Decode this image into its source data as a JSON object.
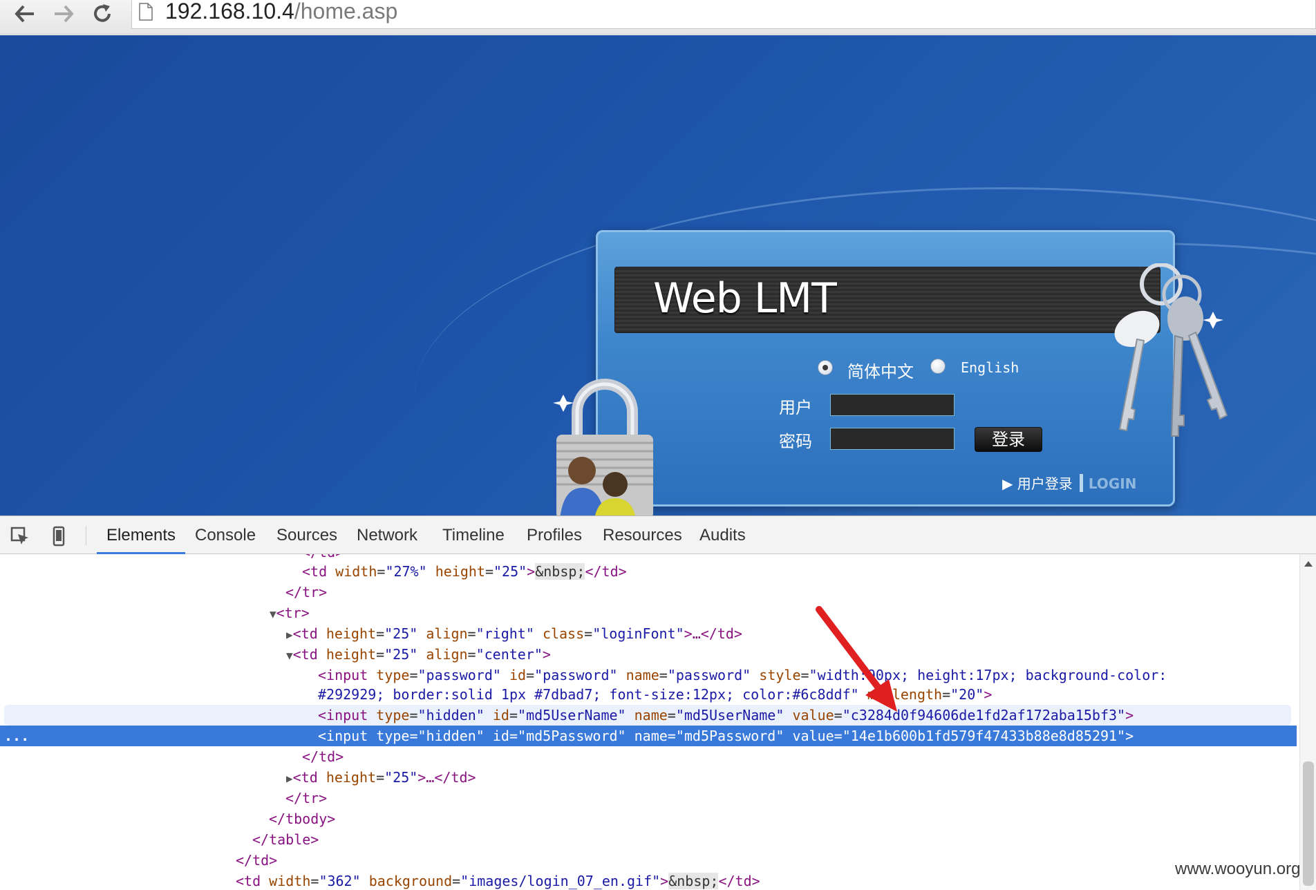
{
  "browser": {
    "url_host": "192.168.10.4",
    "url_path": "/home.asp"
  },
  "login_page": {
    "title": "Web LMT",
    "language_options": [
      {
        "label": "简体中文",
        "selected": true
      },
      {
        "label": "English",
        "selected": false
      }
    ],
    "username_label": "用户",
    "password_label": "密码",
    "login_button": "登录",
    "footer_login_cn": "▶ 用户登录",
    "footer_login_en": "LOGIN"
  },
  "devtools": {
    "tabs": [
      "Elements",
      "Console",
      "Sources",
      "Network",
      "Timeline",
      "Profiles",
      "Resources",
      "Audits"
    ],
    "active_tab": "Elements",
    "selection_ellipsis": "..."
  },
  "code": {
    "l1": {
      "tag1": "<td",
      "a1": "width",
      "v1": "\"27%\"",
      "a2": "height",
      "v2": "\"25\"",
      "t1": ">",
      "ent": "&nbsp;",
      "t2": "</td>"
    },
    "l2": {
      "tag": "</tr>"
    },
    "l3": {
      "tag": "<tr>"
    },
    "l4": {
      "tag1": "<td",
      "a1": "height",
      "v1": "\"25\"",
      "a2": "align",
      "v2": "\"right\"",
      "a3": "class",
      "v3": "\"loginFont\"",
      "t2": ">…</td>"
    },
    "l5": {
      "tag1": "<td",
      "a1": "height",
      "v1": "\"25\"",
      "a2": "align",
      "v2": "\"center\"",
      "t2": ">"
    },
    "l6": {
      "tag1": "<input",
      "a1": "type",
      "v1": "\"password\"",
      "a2": "id",
      "v2": "\"password\"",
      "a3": "name",
      "v3": "\"password\"",
      "a4": "style",
      "v4": "\"width:90px; height:17px; background-color:"
    },
    "l7": {
      "v1": "#292929; border:solid 1px #7dbad7; font-size:12px; color:#6c8ddf\"",
      "a1": "maxlength",
      "v2": "\"20\"",
      "t2": ">"
    },
    "l8": {
      "tag1": "<input",
      "a1": "type",
      "v1": "\"hidden\"",
      "a2": "id",
      "v2": "\"md5UserName\"",
      "a3": "name",
      "v3": "\"md5UserName\"",
      "a4": "value",
      "v4": "\"c3284d0f94606de1fd2af172aba15bf3\"",
      "t2": ">"
    },
    "l9": {
      "tag1": "<input",
      "a1": "type",
      "v1": "\"hidden\"",
      "a2": "id",
      "v2": "\"md5Password\"",
      "a3": "name",
      "v3": "\"md5Password\"",
      "a4": "value",
      "v4": "\"14e1b600b1fd579f47433b88e8d85291\"",
      "t2": ">"
    },
    "l10": {
      "tag": "</td>"
    },
    "l11": {
      "tag1": "<td",
      "a1": "height",
      "v1": "\"25\"",
      "t2": ">…</td>"
    },
    "l12": {
      "tag": "</tr>"
    },
    "l13": {
      "tag": "</tbody>"
    },
    "l14": {
      "tag": "</table>"
    },
    "l15": {
      "tag": "</td>"
    },
    "l16": {
      "tag1": "<td",
      "a1": "width",
      "v1": "\"362\"",
      "a2": "background",
      "v2": "\"images/login_07_en.gif\"",
      "t1": ">",
      "ent": "&nbsp;",
      "t2": "</td>"
    }
  },
  "watermark": "www.wooyun.org",
  "colors": {
    "page_bg": "#1d55aa",
    "devtools_selection": "#3879d9",
    "annotation_arrow": "#e02020"
  }
}
